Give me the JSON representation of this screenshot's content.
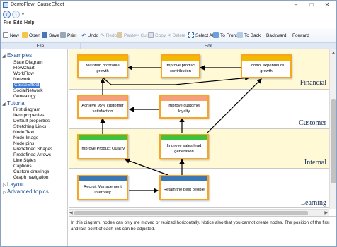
{
  "window": {
    "title": "DemoFlow: CauseEffect"
  },
  "menu": [
    "File",
    "Edit",
    "Help"
  ],
  "ribbon": {
    "file_buttons": [
      {
        "label": "New",
        "icon": "new-icon"
      },
      {
        "label": "Open",
        "icon": "open-folder-icon"
      },
      {
        "label": "Save",
        "icon": "save-icon"
      },
      {
        "label": "Print",
        "icon": "print-icon"
      }
    ],
    "edit_buttons": [
      {
        "label": "Undo",
        "icon": "undo-icon",
        "enabled": true
      },
      {
        "label": "Redo",
        "icon": "redo-icon",
        "enabled": false
      },
      {
        "label": "Paste",
        "icon": "paste-icon",
        "enabled": false
      },
      {
        "label": "Cut",
        "icon": "cut-icon",
        "enabled": false
      },
      {
        "label": "Copy",
        "icon": "copy-icon",
        "enabled": false
      },
      {
        "label": "Delete",
        "icon": "delete-icon",
        "enabled": false
      },
      {
        "label": "Select All",
        "icon": "select-all-icon",
        "enabled": true
      },
      {
        "label": "To Front",
        "icon": "to-front-icon",
        "enabled": true
      },
      {
        "label": "To Back",
        "icon": "to-back-icon",
        "enabled": true
      },
      {
        "label": "Backward",
        "icon": "",
        "enabled": true
      },
      {
        "label": "Forward",
        "icon": "",
        "enabled": true
      }
    ],
    "groups": {
      "file": "File",
      "edit": "Edit"
    }
  },
  "tree": {
    "examples": {
      "label": "Examples",
      "items": [
        "State Diagram",
        "FlowChart",
        "WorkFlow",
        "Network",
        "CauseEffect",
        "SocialNetwork",
        "Genealogy"
      ],
      "selected": "CauseEffect"
    },
    "tutorial": {
      "label": "Tutorial",
      "items": [
        "First diagram",
        "Item properties",
        "Default properties",
        "Stretching Links",
        "Node Text",
        "Node Image",
        "Node pins",
        "Predefined Shapes",
        "Predefined Arrows",
        "Line Styles",
        "Captions",
        "Custom drawings",
        "Graph navigation"
      ]
    },
    "layout": {
      "label": "Layout"
    },
    "advanced": {
      "label": "Advanced topics"
    }
  },
  "diagram": {
    "lanes": [
      "Financial",
      "Customer",
      "Internal",
      "Learning"
    ],
    "nodes": {
      "n_profit": {
        "text": "Maintain profitable growth",
        "header_color": "#f5b800"
      },
      "n_contrib": {
        "text": "Improve product contribution",
        "header_color": "#f5b800"
      },
      "n_expend": {
        "text": "Control expenditure growth",
        "header_color": "#f5b800"
      },
      "n_satisf": {
        "text": "Achieve 95% customer satisfaction",
        "header_color": "#f6a07a"
      },
      "n_loyalty": {
        "text": "Improve customer loyalty",
        "header_color": "#f6a07a"
      },
      "n_quality": {
        "text": "Improve Product Quality",
        "header_color": "#3cc43c"
      },
      "n_sales": {
        "text": "Improve sales lead generation",
        "header_color": "#3cc43c"
      },
      "n_recruit": {
        "text": "Recruit Management internally",
        "header_color": "#3c78b4"
      },
      "n_retain": {
        "text": "Retain the best people",
        "header_color": "#3c78b4"
      }
    }
  },
  "info_text": "In this diagram, nodes can only me moved or resized horizontally. Notice also that you cannot create nodes. The position of the first and last point of each link can be adjusted."
}
